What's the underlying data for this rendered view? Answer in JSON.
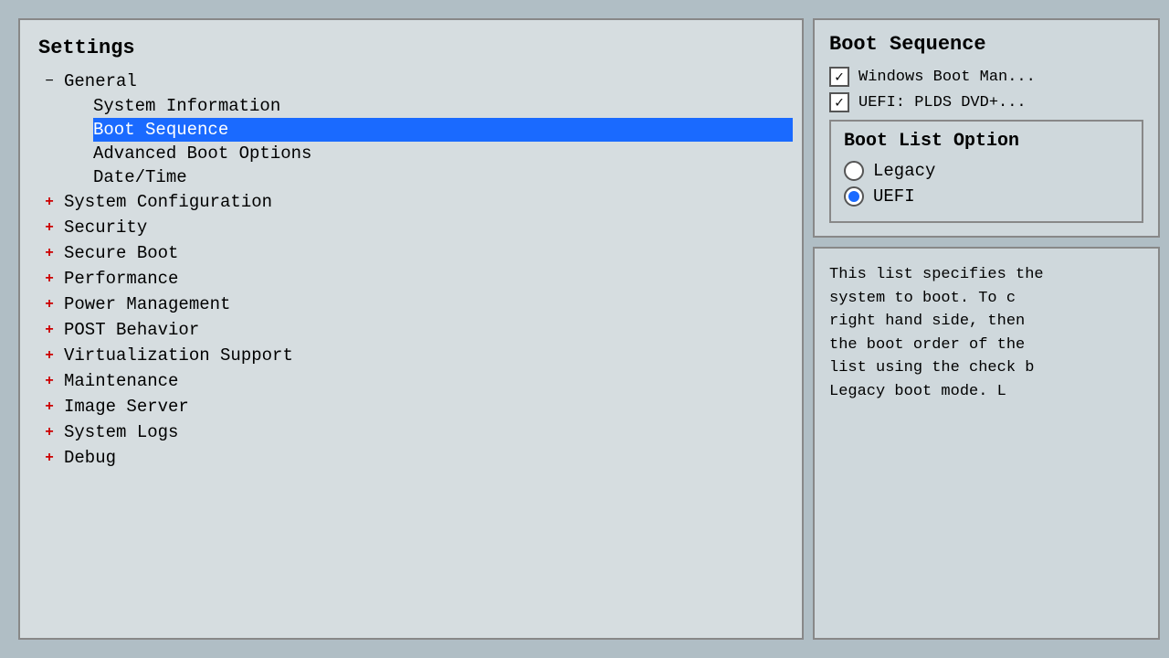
{
  "left": {
    "title": "Settings",
    "tree": {
      "general": {
        "label": "General",
        "expander": "minus",
        "children": [
          {
            "label": "System Information",
            "selected": false
          },
          {
            "label": "Boot Sequence",
            "selected": true
          },
          {
            "label": "Advanced Boot Options",
            "selected": false
          },
          {
            "label": "Date/Time",
            "selected": false
          }
        ]
      },
      "toplevel_items": [
        {
          "label": "System Configuration",
          "expander": "plus"
        },
        {
          "label": "Security",
          "expander": "plus"
        },
        {
          "label": "Secure Boot",
          "expander": "plus"
        },
        {
          "label": "Performance",
          "expander": "plus"
        },
        {
          "label": "Power Management",
          "expander": "plus"
        },
        {
          "label": "POST Behavior",
          "expander": "plus"
        },
        {
          "label": "Virtualization Support",
          "expander": "plus"
        },
        {
          "label": "Maintenance",
          "expander": "plus"
        },
        {
          "label": "Image Server",
          "expander": "plus"
        },
        {
          "label": "System Logs",
          "expander": "plus"
        },
        {
          "label": "Debug",
          "expander": "plus"
        }
      ]
    }
  },
  "right": {
    "boot_sequence": {
      "title": "Boot Sequence",
      "items": [
        {
          "label": "Windows Boot Man...",
          "checked": true
        },
        {
          "label": "UEFI: PLDS DVD+...",
          "checked": true
        }
      ]
    },
    "boot_list_option": {
      "title": "Boot List Option",
      "options": [
        {
          "label": "Legacy",
          "selected": false
        },
        {
          "label": "UEFI",
          "selected": true
        }
      ]
    },
    "description": "This list specifies the system to boot. To c right hand side, then the boot order of the list using the check b Legacy boot mode. L"
  }
}
